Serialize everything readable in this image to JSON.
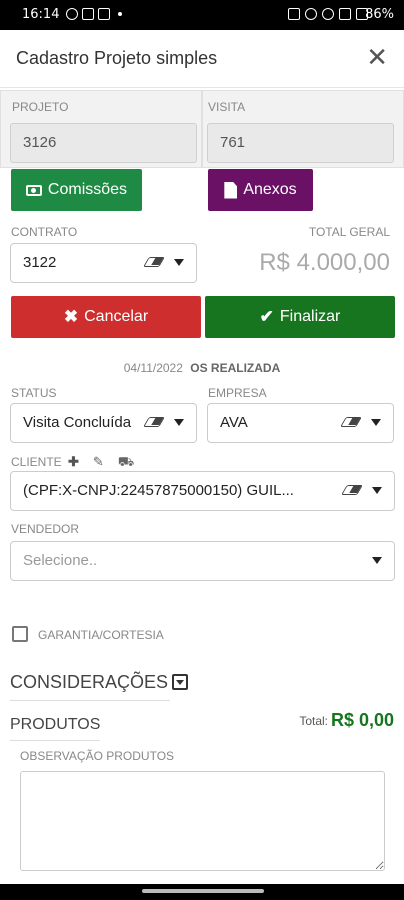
{
  "status_bar": {
    "time": "16:14",
    "battery": "86%"
  },
  "header": {
    "title": "Cadastro Projeto simples",
    "close_icon": "close-icon"
  },
  "projeto": {
    "label": "PROJETO",
    "value": "3126"
  },
  "visita": {
    "label": "VISITA",
    "value": "761"
  },
  "buttons": {
    "comissoes": "Comissões",
    "anexos": "Anexos",
    "cancelar": "Cancelar",
    "finalizar": "Finalizar"
  },
  "contrato": {
    "label": "CONTRATO",
    "value": "3122"
  },
  "total_geral": {
    "label": "TOTAL GERAL",
    "value": "R$ 4.000,00"
  },
  "os": {
    "date": "04/11/2022",
    "status": "OS REALIZADA"
  },
  "status_field": {
    "label": "STATUS",
    "value": "Visita Concluída"
  },
  "empresa": {
    "label": "EMPRESA",
    "value": "AVA"
  },
  "cliente": {
    "label": "CLIENTE",
    "value": "(CPF:X-CNPJ:22457875000150) GUIL..."
  },
  "vendedor": {
    "label": "VENDEDOR",
    "placeholder": "Selecione.."
  },
  "garantia": {
    "label": "GARANTIA/CORTESIA",
    "checked": false
  },
  "consideracoes": {
    "title": "CONSIDERAÇÕES"
  },
  "produtos": {
    "title": "PRODUTOS",
    "total_label": "Total:",
    "total_value": "R$ 0,00"
  },
  "observacao": {
    "label": "OBSERVAÇÃO PRODUTOS"
  },
  "colors": {
    "green": "#1e8a44",
    "purple": "#6a1166",
    "red": "#cf2e2e",
    "dark_green": "#18751f"
  }
}
